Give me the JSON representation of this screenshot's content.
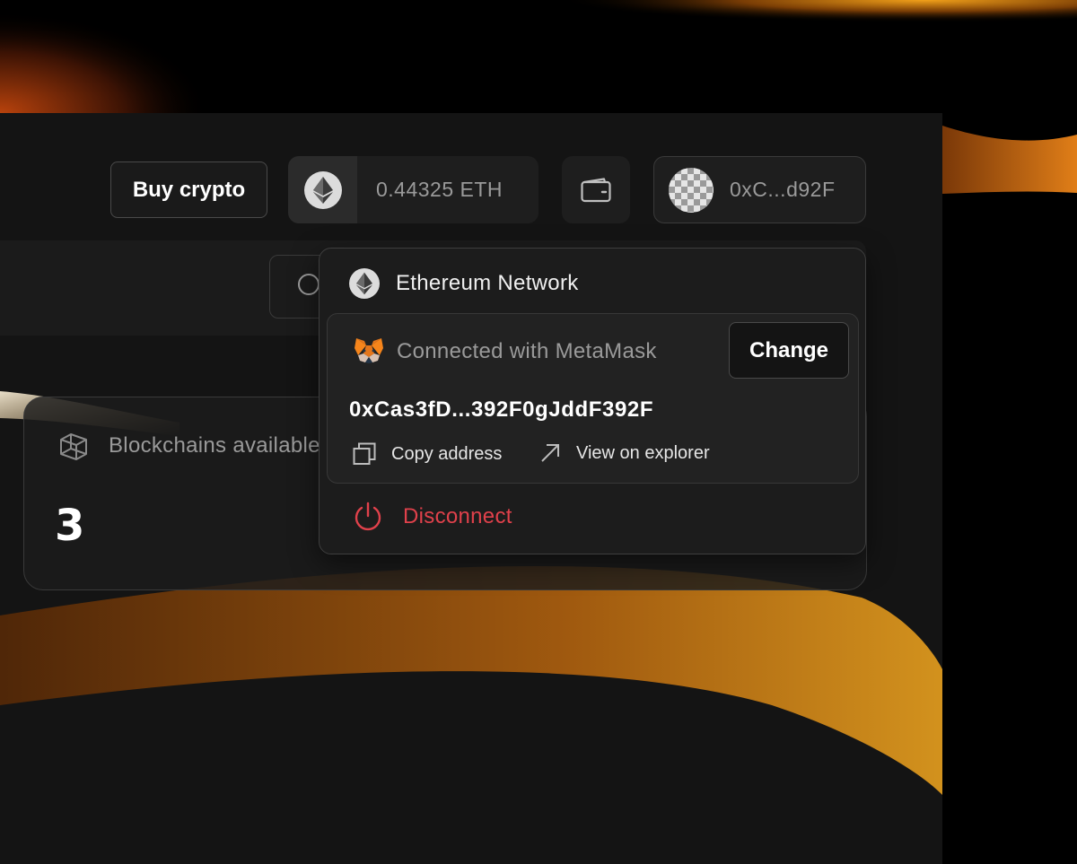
{
  "header": {
    "buy_button_label": "Buy crypto",
    "balance": "0.44325 ETH",
    "account_short": "0xC...d92F"
  },
  "stats": {
    "label": "Blockchains available",
    "value": "3"
  },
  "wallet_menu": {
    "network_name": "Ethereum Network",
    "connected_label": "Connected with MetaMask",
    "change_button_label": "Change",
    "full_address": "0xCas3fD...392F0gJddF392F",
    "copy_label": "Copy address",
    "explorer_label": "View on explorer",
    "disconnect_label": "Disconnect"
  },
  "icons": {
    "eth": "ethereum-icon",
    "wallet": "wallet-icon",
    "search": "search-icon",
    "blockchain": "cube-icon",
    "metamask": "metamask-fox-icon",
    "copy": "copy-icon",
    "explorer": "arrow-up-right-icon",
    "disconnect": "power-icon"
  },
  "colors": {
    "accent": "#f5a623",
    "danger": "#e0414b",
    "panel": "#141414"
  }
}
